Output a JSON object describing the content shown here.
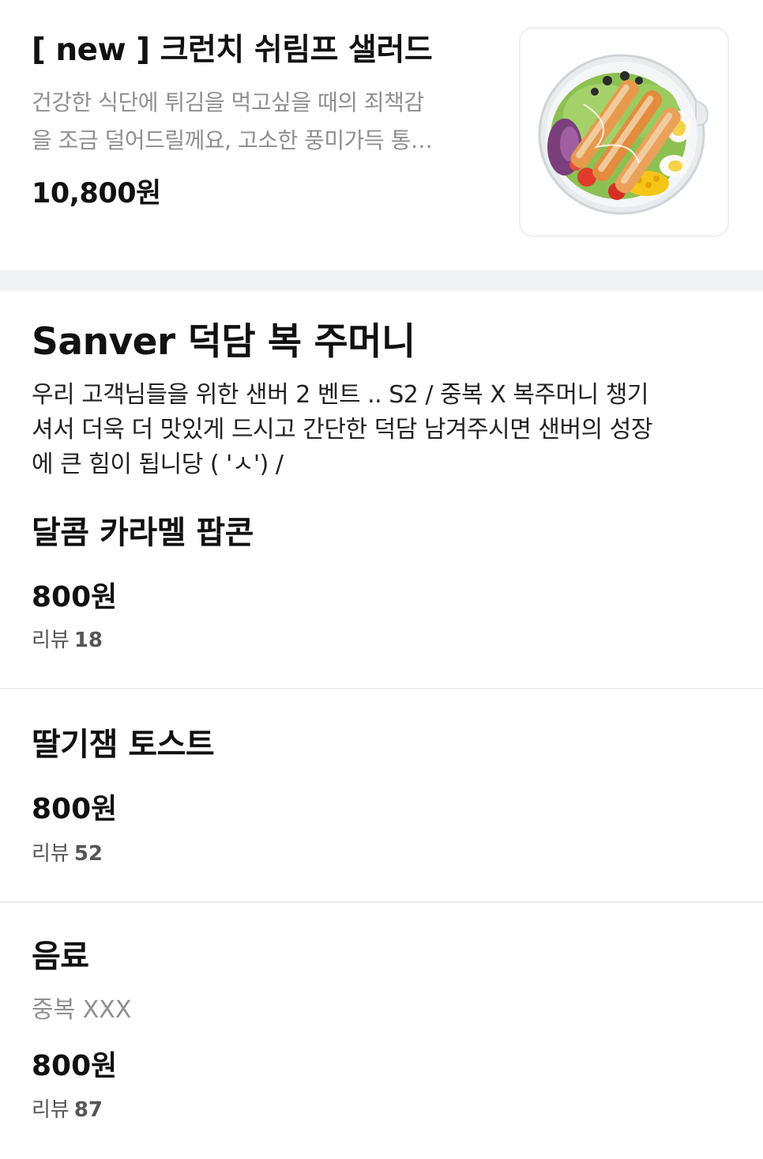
{
  "featured": {
    "title": "[ new ] 크런치 쉬림프 샐러드",
    "desc_line1": "건강한 식단에 튀김을 먹고싶을 때의 죄책감",
    "desc_line2": "을 조금 덜어드릴께요, 고소한 풍미가득 통…",
    "price": "10,800원",
    "image_icon": "shrimp-salad-photo"
  },
  "section": {
    "title": "Sanver 덕담 복 주머니",
    "desc_line1": "우리 고객님들을 위한 샌버 2 벤트 .. S2 / 중복 X  복주머니 챙기",
    "desc_line2": "셔서 더욱 더 맛있게 드시고  간단한 덕담 남겨주시면 샌버의 성장",
    "desc_line3": "에 큰 힘이 됩니당   ( 'ㅅ') /"
  },
  "items": [
    {
      "name": "달콤 카라멜 팝콘",
      "price": "800원",
      "review_label": "리뷰",
      "review_count": "18"
    },
    {
      "name": "딸기잼 토스트",
      "price": "800원",
      "review_label": "리뷰",
      "review_count": "52"
    },
    {
      "name": "음료",
      "sub": "중복 XXX",
      "price": "800원",
      "review_label": "리뷰",
      "review_count": "87"
    }
  ],
  "colors": {
    "divider": "#f2f3f5",
    "muted_text": "#8f8f8f",
    "primary_text": "#111111"
  }
}
